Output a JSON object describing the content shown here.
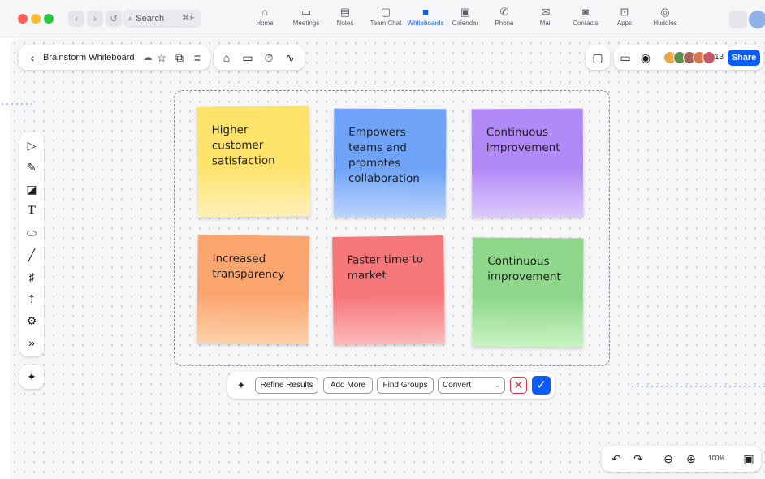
{
  "titlebar": {
    "search_label": "Search",
    "search_shortcut": "⌘F",
    "nav": [
      {
        "label": "Home",
        "icon": "home-icon",
        "glyph": "⌂"
      },
      {
        "label": "Meetings",
        "icon": "video-icon",
        "glyph": "▭"
      },
      {
        "label": "Notes",
        "icon": "notes-icon",
        "glyph": "▤"
      },
      {
        "label": "Team Chat",
        "icon": "chat-icon",
        "glyph": "▢"
      },
      {
        "label": "Whiteboards",
        "icon": "whiteboard-icon",
        "glyph": "■"
      },
      {
        "label": "Calendar",
        "icon": "calendar-icon",
        "glyph": "▣"
      },
      {
        "label": "Phone",
        "icon": "phone-icon",
        "glyph": "✆"
      },
      {
        "label": "Mail",
        "icon": "mail-icon",
        "glyph": "✉"
      },
      {
        "label": "Contacts",
        "icon": "contacts-icon",
        "glyph": "◙"
      },
      {
        "label": "Apps",
        "icon": "apps-icon",
        "glyph": "⊡"
      },
      {
        "label": "Huddles",
        "icon": "huddles-icon",
        "glyph": "◎"
      }
    ],
    "active_nav": "Whiteboards"
  },
  "board": {
    "title": "Brainstorm Whiteboard",
    "participant_count": "13",
    "share_label": "Share"
  },
  "notes": [
    {
      "text": "Higher customer satisfaction",
      "color_top": "#fde36a",
      "color_bottom": "#fdf0b8"
    },
    {
      "text": "Empowers teams and promotes collaboration",
      "color_top": "#6ea3f7",
      "color_bottom": "#b9d3fb"
    },
    {
      "text": "Continuous improvement",
      "color_top": "#b28af7",
      "color_bottom": "#dcc9fb"
    },
    {
      "text": "Increased transparency",
      "color_top": "#fba56e",
      "color_bottom": "#fdd0a9"
    },
    {
      "text": "Faster time to market",
      "color_top": "#f6777a",
      "color_bottom": "#fbb9ba"
    },
    {
      "text": "Continuous improvement",
      "color_top": "#8fd88b",
      "color_bottom": "#c8f3c2"
    }
  ],
  "ai_bar": {
    "refine_label": "Refine Results",
    "add_more_label": "Add More",
    "find_groups_label": "Find Groups",
    "convert_value": "Convert"
  },
  "zoom": {
    "level": "100%"
  },
  "colors": {
    "accent": "#0b5cff",
    "reject": "#d9303a"
  }
}
